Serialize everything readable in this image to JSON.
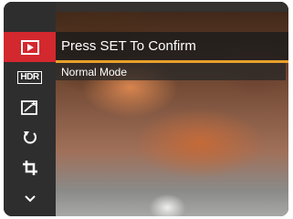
{
  "menu": {
    "title": "Press SET To Confirm",
    "selected_option": "Normal Mode"
  },
  "sidebar": {
    "items": [
      {
        "icon": "play-icon",
        "active": true
      },
      {
        "icon": "hdr-icon",
        "label": "HDR"
      },
      {
        "icon": "magic-frame-icon"
      },
      {
        "icon": "rotate-icon"
      },
      {
        "icon": "crop-icon"
      },
      {
        "icon": "chevron-down-icon"
      }
    ]
  },
  "colors": {
    "accent": "#d3282e",
    "highlight": "#e8a02a",
    "sidebar": "#2e2e2e"
  }
}
